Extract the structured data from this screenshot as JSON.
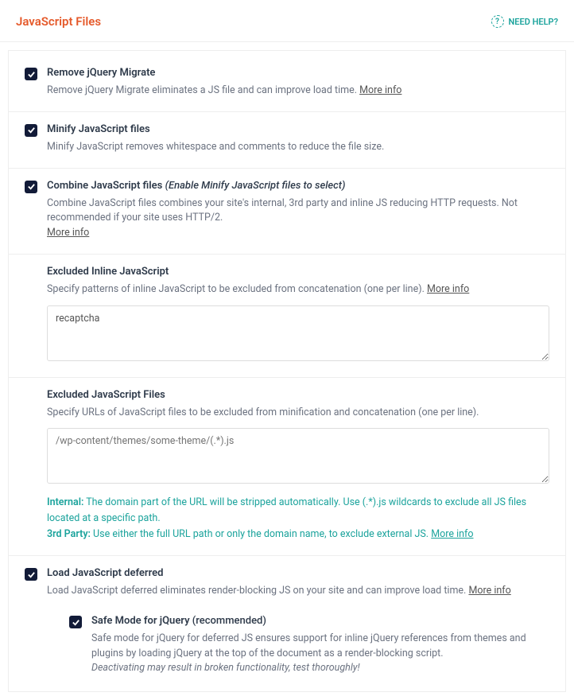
{
  "header": {
    "title": "JavaScript Files",
    "help": "NEED HELP?"
  },
  "moreInfo": "More info",
  "sections": {
    "removeMigrate": {
      "label": "Remove jQuery Migrate",
      "desc": "Remove jQuery Migrate eliminates a JS file and can improve load time."
    },
    "minify": {
      "label": "Minify JavaScript files",
      "desc": "Minify JavaScript removes whitespace and comments to reduce the file size."
    },
    "combine": {
      "label": "Combine JavaScript files",
      "note": "(Enable Minify JavaScript files to select)",
      "desc": "Combine JavaScript files combines your site's internal, 3rd party and inline JS reducing HTTP requests. Not recommended if your site uses HTTP/2."
    },
    "excludedInline": {
      "label": "Excluded Inline JavaScript",
      "desc": "Specify patterns of inline JavaScript to be excluded from concatenation (one per line).",
      "value": "recaptcha"
    },
    "excludedFiles": {
      "label": "Excluded JavaScript Files",
      "desc": "Specify URLs of JavaScript files to be excluded from minification and concatenation (one per line).",
      "placeholder": "/wp-content/themes/some-theme/(.*).js",
      "hint1Label": "Internal:",
      "hint1Text": " The domain part of the URL will be stripped automatically. Use (.*).js wildcards to exclude all JS files located at a specific path.",
      "hint2Label": "3rd Party:",
      "hint2Text": " Use either the full URL path or only the domain name, to exclude external JS."
    },
    "defer": {
      "label": "Load JavaScript deferred",
      "desc": "Load JavaScript deferred eliminates render-blocking JS on your site and can improve load time."
    },
    "safeMode": {
      "label": "Safe Mode for jQuery",
      "rec": "(recommended)",
      "desc": "Safe mode for jQuery for deferred JS ensures support for inline jQuery references from themes and plugins by loading jQuery at the top of the document as a render-blocking script.",
      "warn": "Deactivating may result in broken functionality, test thoroughly!"
    }
  }
}
